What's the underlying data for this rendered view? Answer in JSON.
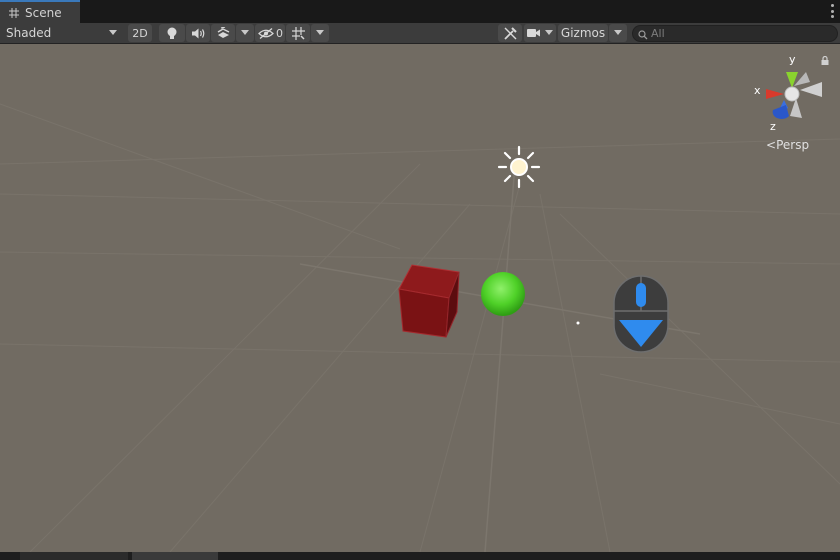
{
  "window": {
    "tab_title": "Scene",
    "tab_icon": "grid-icon",
    "tab_menu_icon": "kebab-icon"
  },
  "toolbar": {
    "draw_mode": "Shaded",
    "mode_2d_label": "2D",
    "hidden_count": "0",
    "gizmos_label": "Gizmos",
    "search_placeholder": "All",
    "icons": [
      "lightbulb-icon",
      "audio-icon",
      "effects-icon",
      "hidden-objects-icon",
      "grid-snap-icon",
      "tools-icon",
      "camera-icon",
      "search-icon"
    ]
  },
  "scene": {
    "projection_label": "Persp",
    "axes": {
      "x": "x",
      "y": "y",
      "z": "z"
    },
    "objects": [
      "directional-light",
      "red-cube",
      "green-sphere",
      "mouse-scroll-hint"
    ],
    "colors": {
      "background": "#716b62",
      "cube": "#7a1214",
      "sphere": "#4fd128",
      "axis_x": "#d83a2c",
      "axis_y": "#8ad32e",
      "axis_z": "#3a6fe0",
      "hint_accent": "#2f8bee"
    }
  },
  "bottom_tabs": [
    "",
    ""
  ]
}
